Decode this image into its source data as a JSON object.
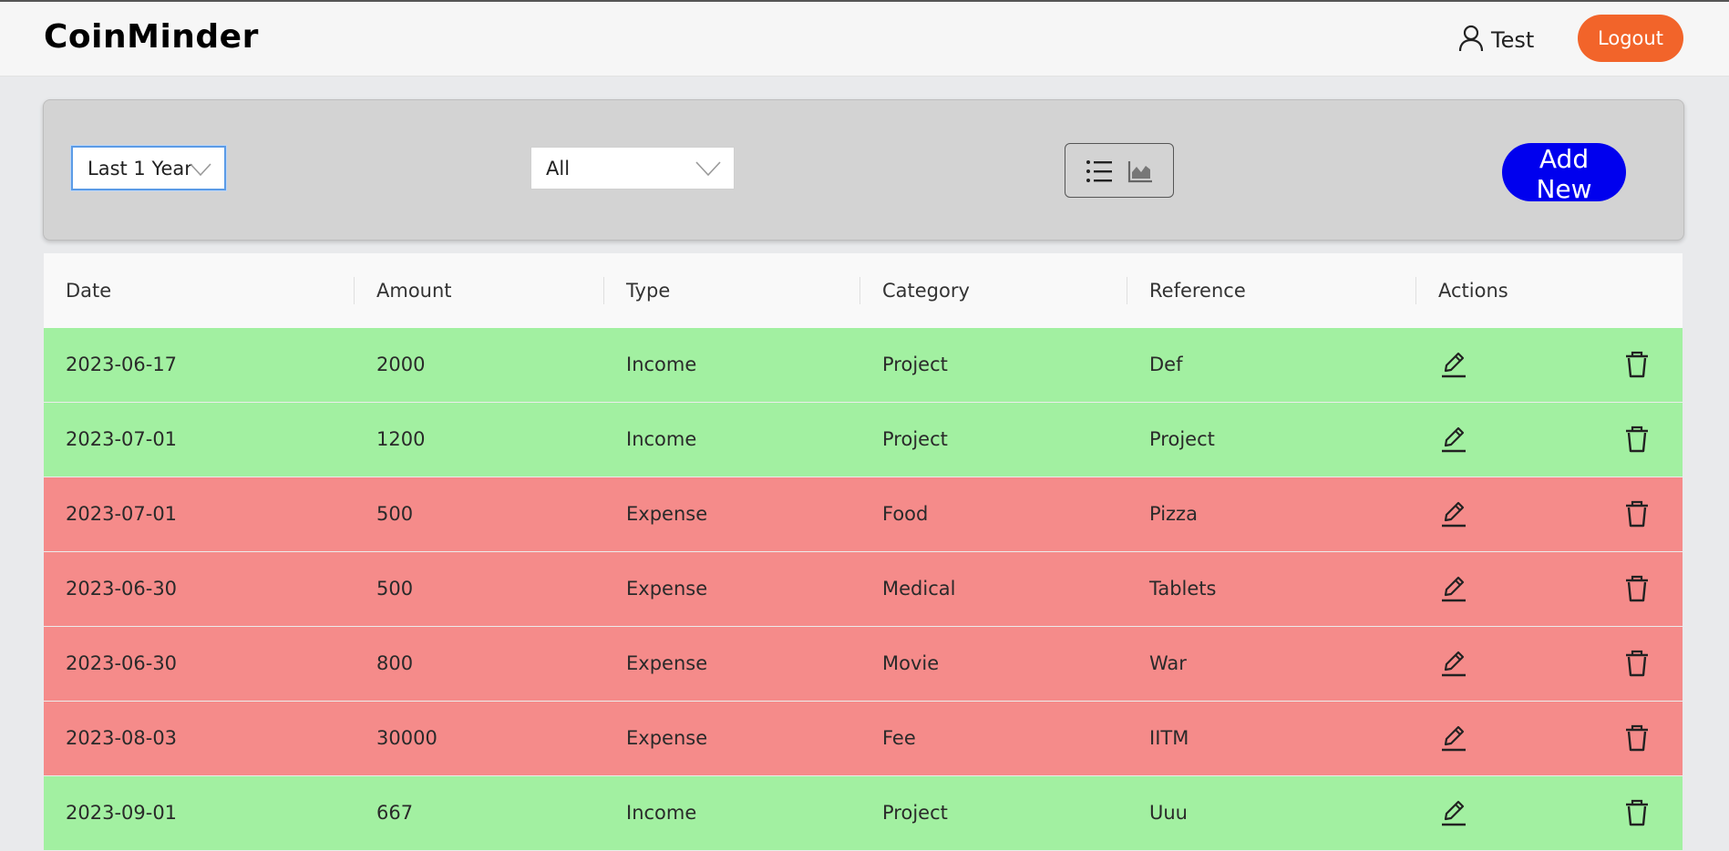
{
  "app": {
    "brand": "CoinMinder"
  },
  "header": {
    "user_name": "Test",
    "logout_label": "Logout"
  },
  "filters": {
    "range_value": "Last 1 Year",
    "type_value": "All",
    "add_new_label": "Add New"
  },
  "table": {
    "columns": [
      "Date",
      "Amount",
      "Type",
      "Category",
      "Reference",
      "Actions"
    ],
    "rows": [
      {
        "date": "2023-06-17",
        "amount": "2000",
        "type": "Income",
        "category": "Project",
        "reference": "Def"
      },
      {
        "date": "2023-07-01",
        "amount": "1200",
        "type": "Income",
        "category": "Project",
        "reference": "Project"
      },
      {
        "date": "2023-07-01",
        "amount": "500",
        "type": "Expense",
        "category": "Food",
        "reference": "Pizza"
      },
      {
        "date": "2023-06-30",
        "amount": "500",
        "type": "Expense",
        "category": "Medical",
        "reference": "Tablets"
      },
      {
        "date": "2023-06-30",
        "amount": "800",
        "type": "Expense",
        "category": "Movie",
        "reference": "War"
      },
      {
        "date": "2023-08-03",
        "amount": "30000",
        "type": "Expense",
        "category": "Fee",
        "reference": "IITM"
      },
      {
        "date": "2023-09-01",
        "amount": "667",
        "type": "Income",
        "category": "Project",
        "reference": "Uuu"
      }
    ]
  },
  "colors": {
    "income_row": "#a2f0a1",
    "expense_row": "#f58b8a",
    "logout": "#f2642a",
    "add_new": "#0000ee"
  },
  "icons": {
    "user": "user-icon",
    "list_view": "list-icon",
    "chart_view": "area-chart-icon",
    "edit": "pencil-icon",
    "delete": "trash-icon",
    "dropdown": "chevron-down-icon"
  }
}
